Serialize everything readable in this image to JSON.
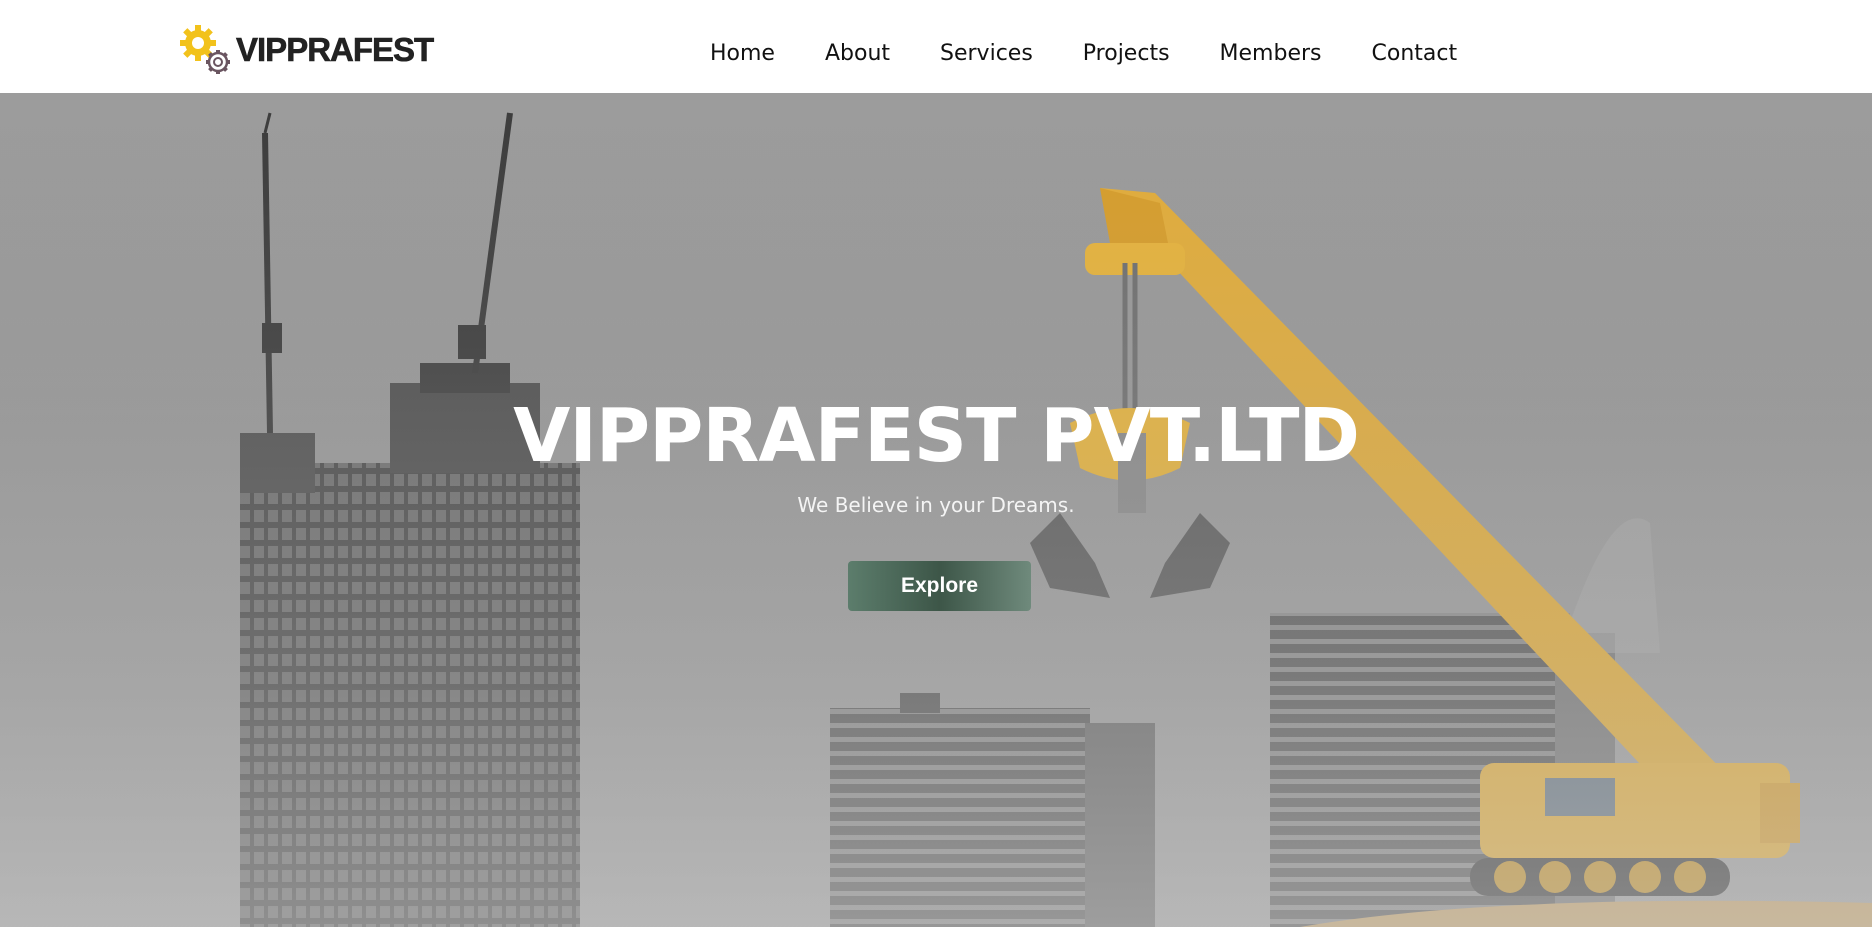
{
  "header": {
    "brand": "VIPPRAFEST",
    "logo_icon": "gear-icon",
    "nav": [
      {
        "label": "Home"
      },
      {
        "label": "About"
      },
      {
        "label": "Services"
      },
      {
        "label": "Projects"
      },
      {
        "label": "Members"
      },
      {
        "label": "Contact"
      }
    ]
  },
  "hero": {
    "title": "VIPPRAFEST PVT.LTD",
    "subtitle": "We Believe in your Dreams.",
    "button_label": "Explore"
  },
  "colors": {
    "header_bg": "#ffffff",
    "hero_overlay": "#9a9a9a",
    "crane_yellow": "#e8b43a",
    "button_green": "#3d5648",
    "gear_yellow": "#f2c21b"
  }
}
